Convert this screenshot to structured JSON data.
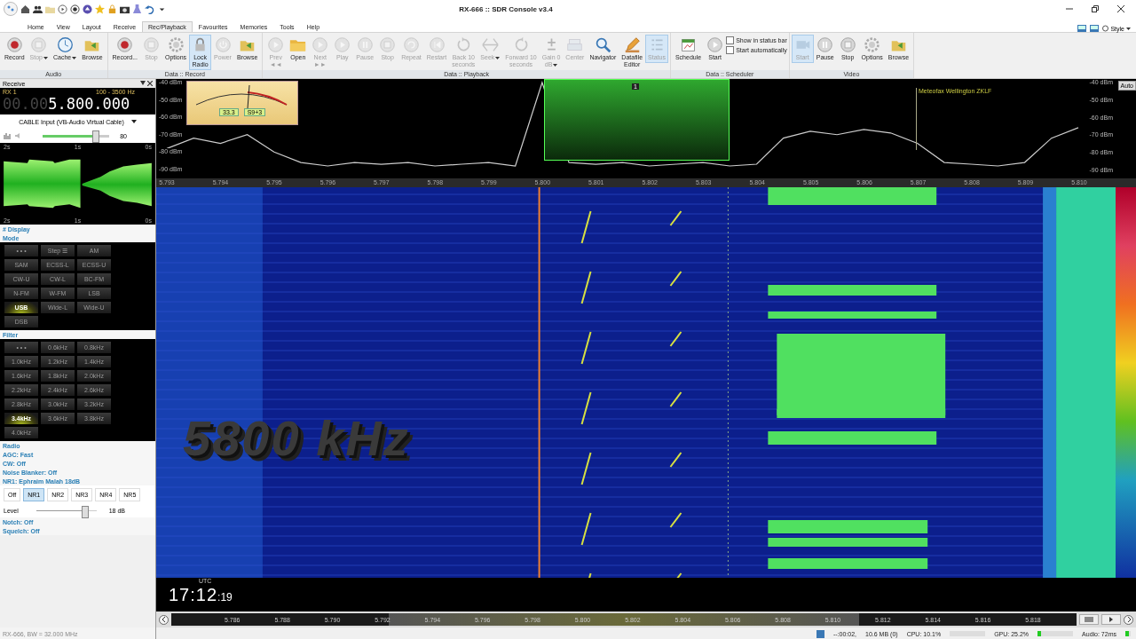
{
  "window": {
    "title": "RX-666 :: SDR Console v3.4"
  },
  "menu_tabs": [
    {
      "label": "Home",
      "selected": false
    },
    {
      "label": "View",
      "selected": false
    },
    {
      "label": "Layout",
      "selected": false
    },
    {
      "label": "Receive",
      "selected": false
    },
    {
      "label": "Rec/Playback",
      "selected": true
    },
    {
      "label": "Favourites",
      "selected": false
    },
    {
      "label": "Memories",
      "selected": false
    },
    {
      "label": "Tools",
      "selected": false
    },
    {
      "label": "Help",
      "selected": false
    }
  ],
  "style_menu": {
    "label": "Style"
  },
  "ribbon_groups": [
    {
      "title": "Audio",
      "items": [
        {
          "kind": "record",
          "label": [
            "Record"
          ],
          "disabled": false,
          "active": false,
          "has_menu": false
        },
        {
          "kind": "stop",
          "label": [
            "Stop"
          ],
          "disabled": true,
          "active": false,
          "has_menu": true
        },
        {
          "kind": "clock",
          "label": [
            "Cache"
          ],
          "disabled": false,
          "active": false,
          "has_menu": true
        },
        {
          "kind": "browse",
          "label": [
            "Browse"
          ],
          "disabled": false,
          "active": false,
          "has_menu": false
        }
      ]
    },
    {
      "title": "Data :: Record",
      "items": [
        {
          "kind": "record",
          "label": [
            "Record..."
          ],
          "disabled": false,
          "active": false,
          "has_menu": false
        },
        {
          "kind": "stop",
          "label": [
            "Stop"
          ],
          "disabled": true,
          "active": false,
          "has_menu": false
        },
        {
          "kind": "gear",
          "label": [
            "Options"
          ],
          "disabled": false,
          "active": false,
          "has_menu": false
        },
        {
          "kind": "lock",
          "label": [
            "Lock",
            "Radio"
          ],
          "disabled": false,
          "active": true,
          "has_menu": false
        },
        {
          "kind": "power",
          "label": [
            "Power"
          ],
          "disabled": true,
          "active": false,
          "has_menu": false
        },
        {
          "kind": "browse",
          "label": [
            "Browse"
          ],
          "disabled": false,
          "active": false,
          "has_menu": false
        }
      ]
    },
    {
      "title": "Data :: Playback",
      "items": [
        {
          "kind": "play",
          "label": [
            "Prev",
            "◄◄"
          ],
          "disabled": true,
          "active": false,
          "has_menu": false
        },
        {
          "kind": "folder",
          "label": [
            "Open"
          ],
          "disabled": false,
          "active": false,
          "has_menu": false
        },
        {
          "kind": "play",
          "label": [
            "Next",
            "►►"
          ],
          "disabled": true,
          "active": false,
          "has_menu": false
        },
        {
          "kind": "play",
          "label": [
            "Play"
          ],
          "disabled": true,
          "active": false,
          "has_menu": false
        },
        {
          "kind": "pause",
          "label": [
            "Pause"
          ],
          "disabled": true,
          "active": false,
          "has_menu": false
        },
        {
          "kind": "stop",
          "label": [
            "Stop"
          ],
          "disabled": true,
          "active": false,
          "has_menu": false
        },
        {
          "kind": "repeat",
          "label": [
            "Repeat"
          ],
          "disabled": true,
          "active": false,
          "has_menu": false
        },
        {
          "kind": "restart",
          "label": [
            "Restart"
          ],
          "disabled": true,
          "active": false,
          "has_menu": false
        },
        {
          "kind": "back",
          "label": [
            "Back 10",
            "seconds"
          ],
          "disabled": true,
          "active": false,
          "has_menu": false
        },
        {
          "kind": "seek",
          "label": [
            "Seek"
          ],
          "disabled": true,
          "active": false,
          "has_menu": true
        },
        {
          "kind": "forward",
          "label": [
            "Forward 10",
            "seconds"
          ],
          "disabled": true,
          "active": false,
          "has_menu": false
        },
        {
          "kind": "gain",
          "label": [
            "Gain 0",
            "dB"
          ],
          "disabled": true,
          "active": false,
          "has_menu": true
        },
        {
          "kind": "center",
          "label": [
            "Center"
          ],
          "disabled": true,
          "active": false,
          "has_menu": false
        },
        {
          "kind": "search",
          "label": [
            "Navigator"
          ],
          "disabled": false,
          "active": false,
          "has_menu": false
        },
        {
          "kind": "pencil",
          "label": [
            "Datafile",
            "Editor"
          ],
          "disabled": false,
          "active": false,
          "has_menu": false
        },
        {
          "kind": "list",
          "label": [
            "Status"
          ],
          "disabled": true,
          "active": true,
          "has_menu": false
        }
      ]
    },
    {
      "title": "Data :: Scheduler",
      "items": [
        {
          "kind": "calendar",
          "label": [
            "Schedule"
          ],
          "disabled": false,
          "active": false,
          "has_menu": false
        },
        {
          "kind": "play",
          "label": [
            "Start"
          ],
          "disabled": false,
          "active": false,
          "has_menu": false
        },
        {
          "kind": "checkbox",
          "label": [
            "Show in status bar"
          ],
          "checked": false
        },
        {
          "kind": "checkbox",
          "label": [
            "Start automatically"
          ],
          "checked": false
        }
      ]
    },
    {
      "title": "Video",
      "items": [
        {
          "kind": "video",
          "label": [
            "Start"
          ],
          "disabled": true,
          "active": true,
          "has_menu": false
        },
        {
          "kind": "pause",
          "label": [
            "Pause"
          ],
          "disabled": false,
          "active": false,
          "has_menu": false
        },
        {
          "kind": "stop",
          "label": [
            "Stop"
          ],
          "disabled": false,
          "active": false,
          "has_menu": false
        },
        {
          "kind": "gear",
          "label": [
            "Options"
          ],
          "disabled": false,
          "active": false,
          "has_menu": false
        },
        {
          "kind": "browse",
          "label": [
            "Browse"
          ],
          "disabled": false,
          "active": false,
          "has_menu": false
        }
      ]
    }
  ],
  "receive_panel": {
    "title": "Receive",
    "receiver": "RX 1",
    "bandwidth": "100 - 3500 Hz",
    "frequency_leading": "00.00",
    "frequency": "5.800.000",
    "audio_device": "CABLE Input (VB-Audio Virtual Cable)",
    "volume": {
      "level": 0.8,
      "reading": "80"
    },
    "scope_ticks_top": [
      "2s",
      "1s",
      "0s"
    ],
    "scope_ticks_bottom": [
      "2s",
      "1s",
      "0s"
    ]
  },
  "display_section": {
    "title": "# Display"
  },
  "mode_section": {
    "title": "Mode",
    "buttons": [
      {
        "label": "• • •",
        "selected": false
      },
      {
        "label": "Step ☰",
        "selected": false
      },
      {
        "label": "AM",
        "selected": false
      },
      {
        "label": "SAM",
        "selected": false
      },
      {
        "label": "ECSS-L",
        "selected": false
      },
      {
        "label": "ECSS-U",
        "selected": false
      },
      {
        "label": "CW-U",
        "selected": false
      },
      {
        "label": "CW-L",
        "selected": false
      },
      {
        "label": "BC-FM",
        "selected": false
      },
      {
        "label": "N-FM",
        "selected": false
      },
      {
        "label": "W-FM",
        "selected": false
      },
      {
        "label": "LSB",
        "selected": false
      },
      {
        "label": "USB",
        "selected": true
      },
      {
        "label": "Wide-L",
        "selected": false
      },
      {
        "label": "Wide-U",
        "selected": false
      },
      {
        "label": "DSB",
        "selected": false
      }
    ]
  },
  "filter_section": {
    "title": "Filter",
    "buttons": [
      {
        "label": "• • •",
        "selected": false
      },
      {
        "label": "0.6kHz",
        "selected": false
      },
      {
        "label": "0.8kHz",
        "selected": false
      },
      {
        "label": "1.0kHz",
        "selected": false
      },
      {
        "label": "1.2kHz",
        "selected": false
      },
      {
        "label": "1.4kHz",
        "selected": false
      },
      {
        "label": "1.6kHz",
        "selected": false
      },
      {
        "label": "1.8kHz",
        "selected": false
      },
      {
        "label": "2.0kHz",
        "selected": false
      },
      {
        "label": "2.2kHz",
        "selected": false
      },
      {
        "label": "2.4kHz",
        "selected": false
      },
      {
        "label": "2.6kHz",
        "selected": false
      },
      {
        "label": "2.8kHz",
        "selected": false
      },
      {
        "label": "3.0kHz",
        "selected": false
      },
      {
        "label": "3.2kHz",
        "selected": false
      },
      {
        "label": "3.4kHz",
        "selected": true
      },
      {
        "label": "3.6kHz",
        "selected": false
      },
      {
        "label": "3.8kHz",
        "selected": false
      },
      {
        "label": "4.0kHz",
        "selected": false
      }
    ]
  },
  "settings_sections": [
    "Radio",
    "AGC: Fast",
    "CW: Off",
    "Noise Blanker: Off",
    "NR1: Ephraim Malah 18dB"
  ],
  "noise_reduction": {
    "buttons": [
      {
        "label": "Off",
        "selected": false
      },
      {
        "label": "NR1",
        "selected": true
      },
      {
        "label": "NR2",
        "selected": false
      },
      {
        "label": "NR3",
        "selected": false
      },
      {
        "label": "NR4",
        "selected": false
      },
      {
        "label": "NR5",
        "selected": false
      }
    ],
    "level_label": "Level",
    "level": 0.82,
    "reading": "18 dB"
  },
  "more_sections": [
    "Notch: Off",
    "Squelch: Off"
  ],
  "panel_status": "RX-666, BW = 32.000 MHz",
  "spectrum": {
    "chart_data": {
      "type": "line",
      "xlim": [
        5.793,
        5.81
      ],
      "ylim": [
        -90,
        -40
      ],
      "x": [
        5.793,
        5.7935,
        5.794,
        5.7945,
        5.795,
        5.7955,
        5.796,
        5.7965,
        5.797,
        5.7975,
        5.798,
        5.7985,
        5.799,
        5.7995,
        5.8,
        5.8005,
        5.801,
        5.8015,
        5.802,
        5.8025,
        5.803,
        5.8035,
        5.804,
        5.8045,
        5.805,
        5.8055,
        5.806,
        5.8065,
        5.807,
        5.8075,
        5.808,
        5.8085,
        5.809,
        5.8095,
        5.81
      ],
      "series": [
        {
          "color": "#cccccc",
          "values": [
            -78,
            -72,
            -75,
            -70,
            -80,
            -86,
            -88,
            -86,
            -87,
            -86,
            -88,
            -87,
            -86,
            -88,
            -40,
            -86,
            -87,
            -86,
            -88,
            -87,
            -86,
            -88,
            -87,
            -72,
            -68,
            -70,
            -67,
            -69,
            -75,
            -86,
            -87,
            -88,
            -86,
            -72,
            -66
          ]
        }
      ],
      "xticks": [
        {
          "value": 5.793,
          "label": "5.793"
        },
        {
          "value": 5.794,
          "label": "5.794"
        },
        {
          "value": 5.795,
          "label": "5.795"
        },
        {
          "value": 5.796,
          "label": "5.796"
        },
        {
          "value": 5.797,
          "label": "5.797"
        },
        {
          "value": 5.798,
          "label": "5.798"
        },
        {
          "value": 5.799,
          "label": "5.799"
        },
        {
          "value": 5.8,
          "label": "5.800"
        },
        {
          "value": 5.801,
          "label": "5.801"
        },
        {
          "value": 5.802,
          "label": "5.802"
        },
        {
          "value": 5.803,
          "label": "5.803"
        },
        {
          "value": 5.804,
          "label": "5.804"
        },
        {
          "value": 5.805,
          "label": "5.805"
        },
        {
          "value": 5.806,
          "label": "5.806"
        },
        {
          "value": 5.807,
          "label": "5.807"
        },
        {
          "value": 5.808,
          "label": "5.808"
        },
        {
          "value": 5.809,
          "label": "5.809"
        },
        {
          "value": 5.81,
          "label": "5.810"
        }
      ],
      "yticks": [
        {
          "value": -40,
          "label": "-40 dBm"
        },
        {
          "value": -50,
          "label": "-50 dBm"
        },
        {
          "value": -60,
          "label": "-60 dBm"
        },
        {
          "value": -70,
          "label": "-70 dBm"
        },
        {
          "value": -80,
          "label": "-80 dBm"
        },
        {
          "value": -90,
          "label": "-90 dBm"
        }
      ]
    },
    "dbm_right": [
      "-40 dBm",
      "-50 dBm",
      "-60 dBm",
      "-70 dBm",
      "-80 dBm",
      "-90 dBm"
    ],
    "auto_button": "Auto",
    "s_meter": {
      "reading": "33.3",
      "s_units": "S9+3"
    },
    "filter_label": "1",
    "marker": "Meteofax Wellington ZKLF"
  },
  "waterfall": {
    "overlay_text": "5800 kHz"
  },
  "clock": {
    "time": "17:12",
    "seconds": ":19",
    "zone": "UTC"
  },
  "overview_scale": [
    "5.786",
    "5.788",
    "5.790",
    "5.792",
    "5.794",
    "5.796",
    "5.798",
    "5.800",
    "5.802",
    "5.804",
    "5.806",
    "5.808",
    "5.810",
    "5.812",
    "5.814",
    "5.816",
    "5.818"
  ],
  "status_bar": {
    "recording": "--:00:02,",
    "size": "10.6 MB (0)",
    "cpu": "CPU: 10.1%",
    "gpu": "GPU: 25.2%",
    "audio": "Audio: 72ms"
  }
}
